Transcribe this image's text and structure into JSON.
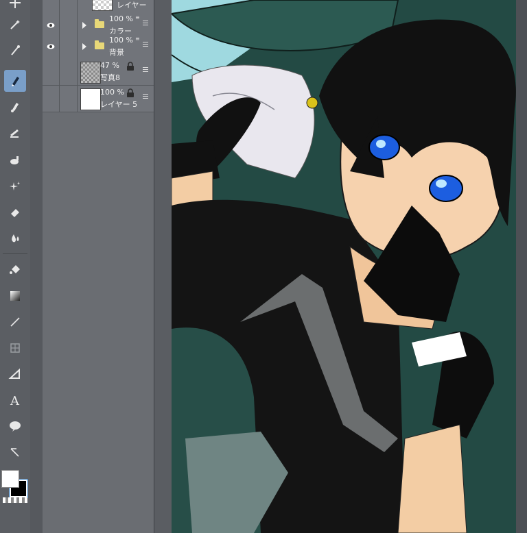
{
  "toolbar": {
    "tools": [
      {
        "icon": "move-icon",
        "active": false
      },
      {
        "icon": "magic-wand-icon",
        "active": false
      },
      {
        "icon": "eyedropper-icon",
        "active": false
      },
      {
        "icon": "pen-icon",
        "active": true
      },
      {
        "icon": "brush-icon",
        "active": false
      },
      {
        "icon": "airbrush-icon",
        "active": false
      },
      {
        "icon": "decoration-icon",
        "active": false
      },
      {
        "icon": "sparkle-icon",
        "active": false
      },
      {
        "icon": "eraser-icon",
        "active": false
      },
      {
        "icon": "blend-icon",
        "active": false
      },
      {
        "icon": "fill-bucket-icon",
        "active": false
      },
      {
        "icon": "gradient-icon",
        "active": false
      },
      {
        "icon": "line-icon",
        "active": false
      },
      {
        "icon": "frame-icon",
        "active": false
      },
      {
        "icon": "ruler-icon",
        "active": false
      },
      {
        "icon": "text-icon",
        "active": false
      },
      {
        "icon": "speech-balloon-icon",
        "active": false
      },
      {
        "icon": "correct-line-icon",
        "active": false
      }
    ],
    "main_color": "#ffffff",
    "sub_color": "#000000"
  },
  "layers": [
    {
      "opacity": "",
      "name": "レイヤー",
      "type": "layer",
      "visible": true
    },
    {
      "opacity": "100 %",
      "name": "カラー",
      "type": "folder",
      "visible": true
    },
    {
      "opacity": "100 %",
      "name": "背景",
      "type": "folder",
      "visible": true
    },
    {
      "opacity": "47 %",
      "name": "写真8",
      "type": "layer",
      "visible": false,
      "locked": true
    },
    {
      "opacity": "100 %",
      "name": "レイヤー 5",
      "type": "layer",
      "visible": false,
      "locked": true
    }
  ],
  "colors": {
    "app_bg": "#4a4d52",
    "panel": "#6a6d72",
    "active_tool": "#7a9fc9",
    "canvas_bg": "#234a44",
    "sky": "#9fd9e0"
  }
}
